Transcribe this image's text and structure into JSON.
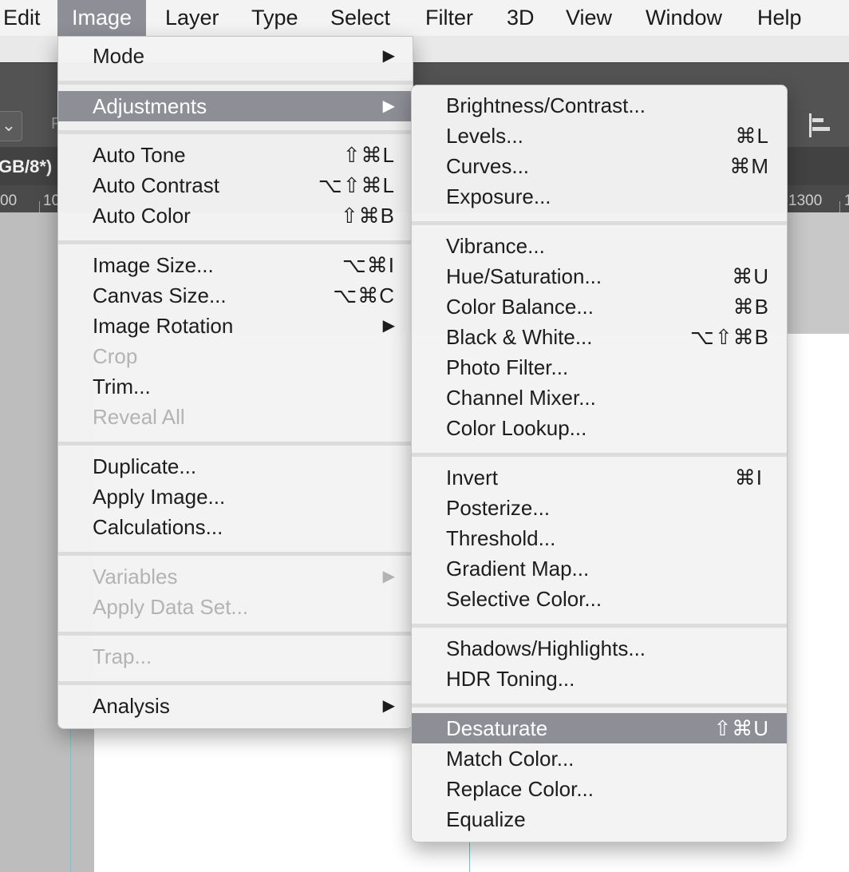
{
  "menubar": {
    "items": [
      {
        "label": "Edit"
      },
      {
        "label": "Image",
        "active": true
      },
      {
        "label": "Layer"
      },
      {
        "label": "Type"
      },
      {
        "label": "Select"
      },
      {
        "label": "Filter"
      },
      {
        "label": "3D"
      },
      {
        "label": "View"
      },
      {
        "label": "Window"
      },
      {
        "label": "Help"
      }
    ]
  },
  "background": {
    "doc_tab_label": "GB/8*)",
    "options_letter": "F",
    "options_dropdown_glyph": "⌄",
    "ruler_labels": [
      "00",
      "10",
      "1300",
      "1"
    ]
  },
  "image_menu": {
    "items": [
      {
        "label": "Mode",
        "submenu": true
      },
      {
        "label": "Adjustments",
        "submenu": true,
        "highlighted": true
      },
      {
        "label": "Auto Tone",
        "shortcut": "⇧⌘L"
      },
      {
        "label": "Auto Contrast",
        "shortcut": "⌥⇧⌘L"
      },
      {
        "label": "Auto Color",
        "shortcut": "⇧⌘B"
      },
      {
        "label": "Image Size...",
        "shortcut": "⌥⌘I"
      },
      {
        "label": "Canvas Size...",
        "shortcut": "⌥⌘C"
      },
      {
        "label": "Image Rotation",
        "submenu": true
      },
      {
        "label": "Crop",
        "disabled": true
      },
      {
        "label": "Trim..."
      },
      {
        "label": "Reveal All",
        "disabled": true
      },
      {
        "label": "Duplicate..."
      },
      {
        "label": "Apply Image..."
      },
      {
        "label": "Calculations..."
      },
      {
        "label": "Variables",
        "submenu": true,
        "disabled": true
      },
      {
        "label": "Apply Data Set...",
        "disabled": true
      },
      {
        "label": "Trap...",
        "disabled": true
      },
      {
        "label": "Analysis",
        "submenu": true
      }
    ]
  },
  "adjustments_menu": {
    "items": [
      {
        "label": "Brightness/Contrast..."
      },
      {
        "label": "Levels...",
        "shortcut": "⌘L"
      },
      {
        "label": "Curves...",
        "shortcut": "⌘M"
      },
      {
        "label": "Exposure..."
      },
      {
        "label": "Vibrance..."
      },
      {
        "label": "Hue/Saturation...",
        "shortcut": "⌘U"
      },
      {
        "label": "Color Balance...",
        "shortcut": "⌘B"
      },
      {
        "label": "Black & White...",
        "shortcut": "⌥⇧⌘B"
      },
      {
        "label": "Photo Filter..."
      },
      {
        "label": "Channel Mixer..."
      },
      {
        "label": "Color Lookup..."
      },
      {
        "label": "Invert",
        "shortcut": "⌘I"
      },
      {
        "label": "Posterize..."
      },
      {
        "label": "Threshold..."
      },
      {
        "label": "Gradient Map..."
      },
      {
        "label": "Selective Color..."
      },
      {
        "label": "Shadows/Highlights..."
      },
      {
        "label": "HDR Toning..."
      },
      {
        "label": "Desaturate",
        "shortcut": "⇧⌘U",
        "highlighted": true
      },
      {
        "label": "Match Color..."
      },
      {
        "label": "Replace Color..."
      },
      {
        "label": "Equalize"
      }
    ]
  },
  "icons": {
    "submenu_arrow": "▶",
    "align_icon": "align-left-icon"
  },
  "colors": {
    "highlight": "#8e8e97",
    "disabled_text": "#b3b3b3",
    "menu_bg": "#f3f3f3",
    "guide": "#58d0d8"
  }
}
